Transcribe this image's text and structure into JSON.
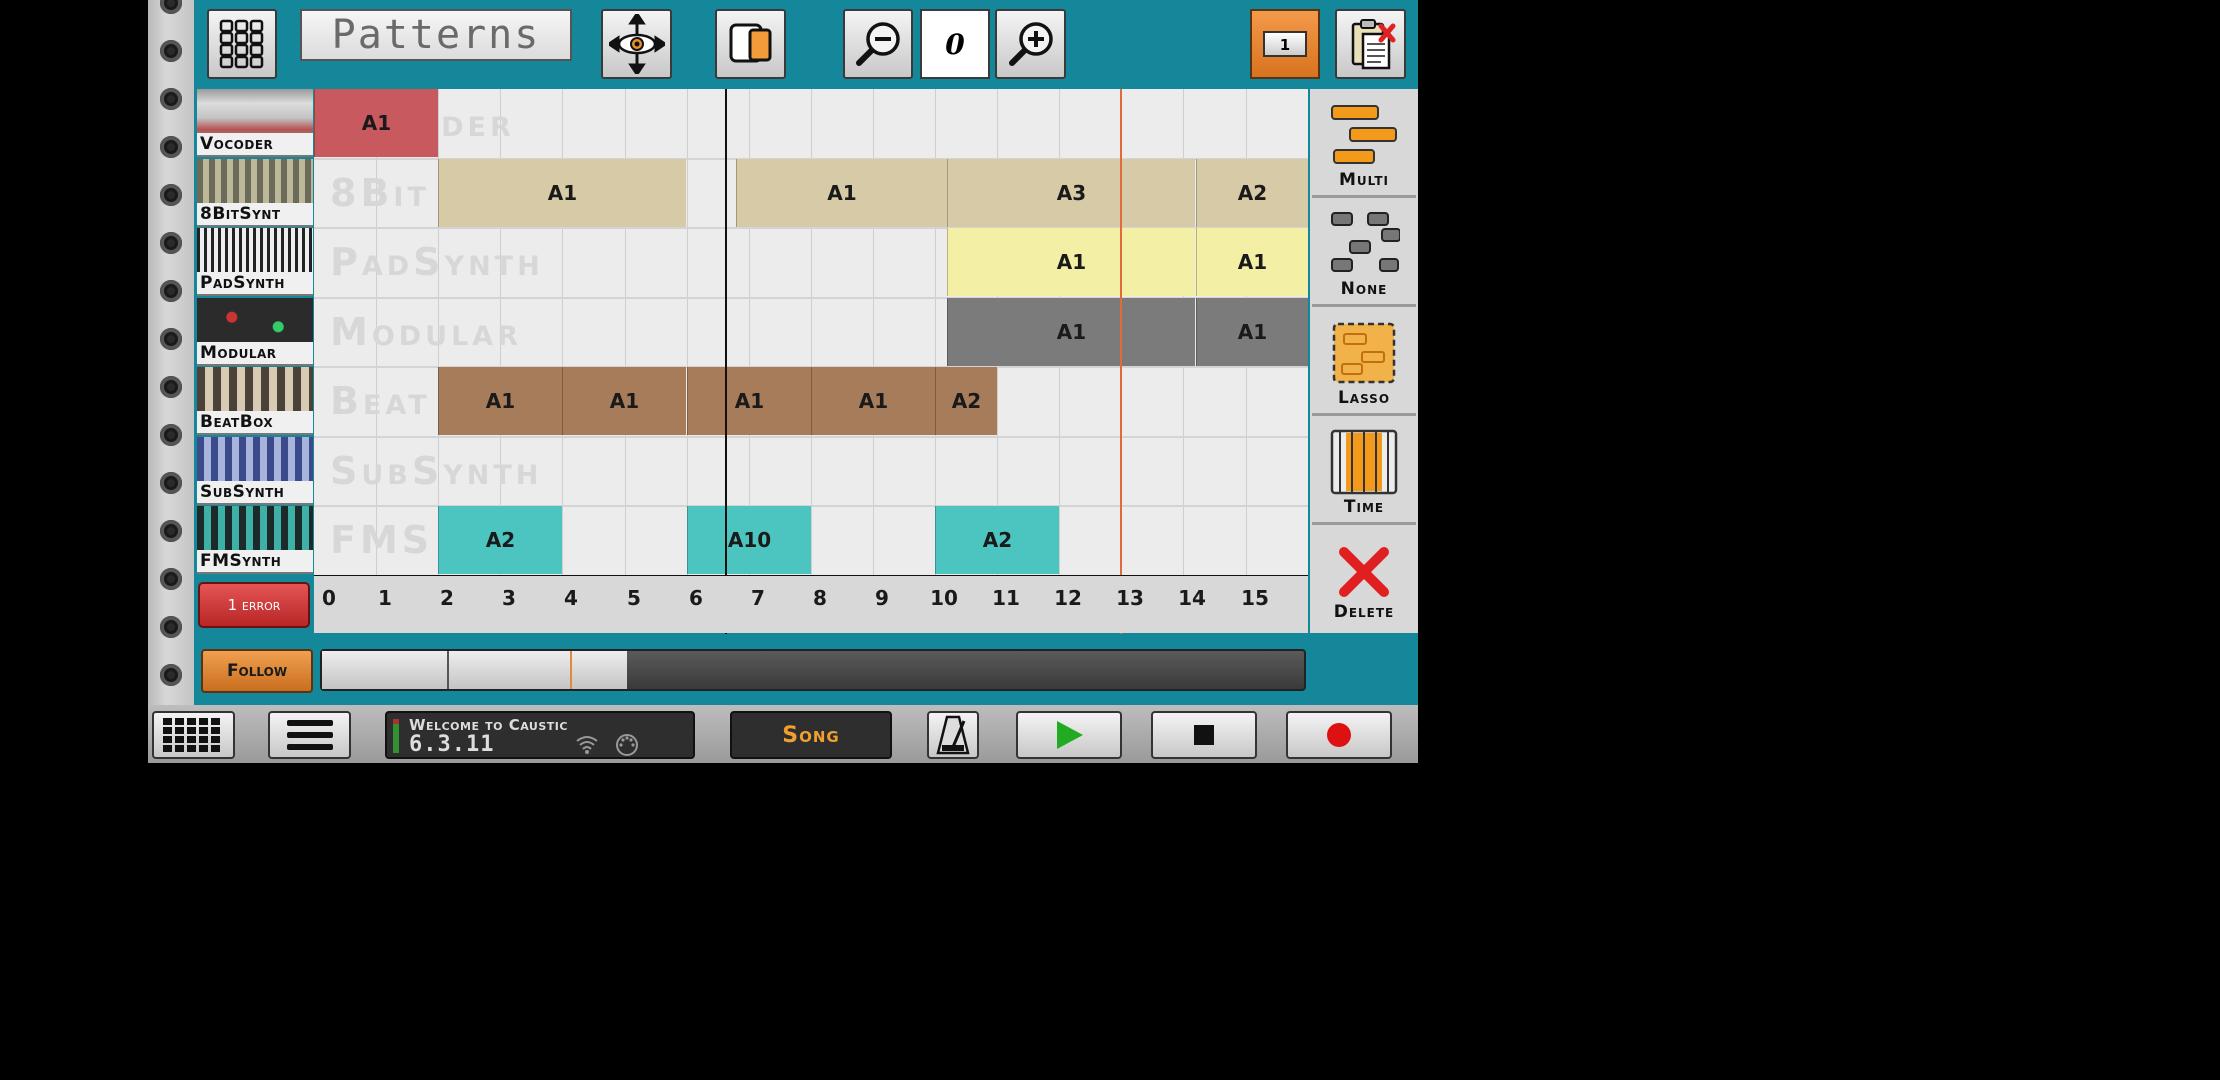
{
  "toolbar": {
    "title": "Patterns",
    "zoom_value": "0",
    "page_number": "1",
    "icons": [
      "grid-menu-icon",
      "move-view-icon",
      "copy-icon",
      "zoom-out-icon",
      "zoom-in-icon",
      "clipboard-delete-icon"
    ]
  },
  "tracks": [
    {
      "name": "Vocoder",
      "ghost": "Vocoder"
    },
    {
      "name": "8BitSynt",
      "ghost": "8Bit"
    },
    {
      "name": "PadSynth",
      "ghost": "PadSynth"
    },
    {
      "name": "Modular",
      "ghost": "Modular"
    },
    {
      "name": "BeatBox",
      "ghost": "Beat"
    },
    {
      "name": "SubSynth",
      "ghost": "SubSynth"
    },
    {
      "name": "FMSynth",
      "ghost": "FMS"
    }
  ],
  "patterns": [
    {
      "track": 0,
      "label": "A1",
      "color": "#c85a5f"
    },
    {
      "track": 1,
      "label": "A1",
      "color": "#d6cba6"
    },
    {
      "track": 1,
      "label": "A1",
      "color": "#d6cba6"
    },
    {
      "track": 1,
      "label": "A3",
      "color": "#d6cba6"
    },
    {
      "track": 1,
      "label": "A2",
      "color": "#d6cba6"
    },
    {
      "track": 2,
      "label": "A1",
      "color": "#f3f0a6"
    },
    {
      "track": 2,
      "label": "A1",
      "color": "#f3f0a6"
    },
    {
      "track": 3,
      "label": "A1",
      "color": "#7b7b7b"
    },
    {
      "track": 3,
      "label": "A1",
      "color": "#7b7b7b"
    },
    {
      "track": 4,
      "label": "A1",
      "color": "#a77c5a"
    },
    {
      "track": 4,
      "label": "A1",
      "color": "#a77c5a"
    },
    {
      "track": 4,
      "label": "A1",
      "color": "#a77c5a"
    },
    {
      "track": 4,
      "label": "A1",
      "color": "#a77c5a"
    },
    {
      "track": 4,
      "label": "A2",
      "color": "#a77c5a"
    },
    {
      "track": 6,
      "label": "A2",
      "color": "#4cc4c0"
    },
    {
      "track": 6,
      "label": "A10",
      "color": "#4cc4c0"
    },
    {
      "track": 6,
      "label": "A2",
      "color": "#4cc4c0"
    }
  ],
  "ruler": {
    "ticks": [
      "0",
      "1",
      "2",
      "3",
      "4",
      "5",
      "6",
      "7",
      "8",
      "9",
      "10",
      "11",
      "12",
      "13",
      "14",
      "15"
    ]
  },
  "error_button": "1 error",
  "tools": [
    {
      "label": "Multi",
      "icon": "multi-select-icon"
    },
    {
      "label": "None",
      "icon": "none-select-icon"
    },
    {
      "label": "Lasso",
      "icon": "lasso-icon"
    },
    {
      "label": "Time",
      "icon": "time-select-icon"
    },
    {
      "label": "Delete",
      "icon": "delete-x-icon"
    }
  ],
  "follow_button": "Follow",
  "status": {
    "message": "Welcome to Caustic",
    "version": "6.3.11"
  },
  "transport": {
    "mode": "Song",
    "icons": [
      "keyboard-icon",
      "hamburger-menu-icon",
      "metronome-icon",
      "play-icon",
      "stop-icon",
      "record-icon"
    ]
  },
  "colors": {
    "panel": "#14889a",
    "accent_orange": "#e0812e",
    "error_red": "#c83030"
  }
}
